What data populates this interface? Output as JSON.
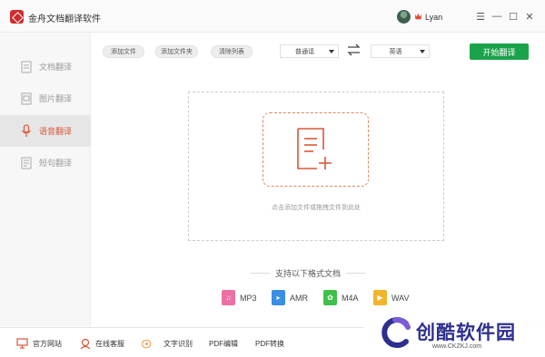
{
  "titlebar": {
    "app_title": "金舟文档翻译软件",
    "username": "Lyan",
    "menu_glyph": "☰",
    "minimize_glyph": "—",
    "maximize_glyph": "☐",
    "close_glyph": "✕"
  },
  "sidebar": {
    "items": [
      {
        "label": "文档翻译",
        "icon": "document-icon",
        "active": false
      },
      {
        "label": "图片翻译",
        "icon": "image-icon",
        "active": false
      },
      {
        "label": "语音翻译",
        "icon": "microphone-icon",
        "active": true
      },
      {
        "label": "短句翻译",
        "icon": "sentence-icon",
        "active": false
      }
    ]
  },
  "toolbar": {
    "add_file": "添加文件",
    "add_folder": "添加文件夹",
    "clear_list": "清除列表",
    "source_language": "普通话",
    "target_language": "英语",
    "start_button": "开始翻译"
  },
  "drop_area": {
    "hint": "点击添加文件或拖拽文件到此处"
  },
  "formats": {
    "title": "支持以下格式文档",
    "items": [
      {
        "name": "MP3",
        "color": "#ee6fa3",
        "glyph": "♫"
      },
      {
        "name": "AMR",
        "color": "#3b8ee6",
        "glyph": "▸"
      },
      {
        "name": "M4A",
        "color": "#3fc04a",
        "glyph": "✿"
      },
      {
        "name": "WAV",
        "color": "#f2b52a",
        "glyph": "▶"
      }
    ]
  },
  "footer": {
    "items": [
      {
        "label": "官方网站",
        "icon": "monitor-icon"
      },
      {
        "label": "在线客服",
        "icon": "support-icon"
      },
      {
        "label": "文字识别",
        "icon": "ocr-icon"
      },
      {
        "label": "PDF编辑",
        "icon": ""
      },
      {
        "label": "PDF转换",
        "icon": ""
      }
    ]
  },
  "watermark": {
    "brand": "创酷软件园",
    "url": "www.CKZKJ.com"
  },
  "colors": {
    "accent": "#d9583a",
    "start_green": "#1aa34a",
    "logo_red": "#cf2d2d"
  }
}
